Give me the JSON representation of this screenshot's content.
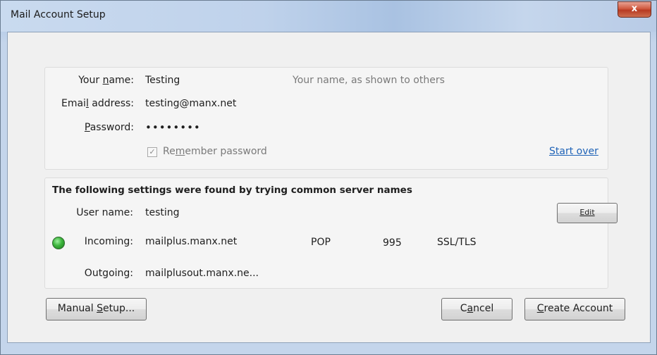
{
  "window": {
    "title": "Mail Account Setup",
    "close_glyph": "x"
  },
  "identity": {
    "name_label_pre": "Your ",
    "name_label_u": "n",
    "name_label_post": "ame:",
    "name_value": "Testing",
    "name_hint": "Your name, as shown to others",
    "email_label_pre": "Emai",
    "email_label_u": "l",
    "email_label_post": " address:",
    "email_value": "testing@manx.net",
    "password_label_u": "P",
    "password_label_post": "assword:",
    "password_value": "••••••••",
    "remember_pre": "Re",
    "remember_u": "m",
    "remember_post": "ember password",
    "remember_checked": true,
    "start_over": "Start over"
  },
  "settings": {
    "heading": "The following settings were found by trying common server names",
    "username_label": "User name:",
    "username_value": "testing",
    "edit_button": "Edit",
    "incoming_label": "Incoming:",
    "incoming_server": "mailplus.manx.net",
    "incoming_protocol": "POP",
    "incoming_port": "995",
    "incoming_security": "SSL/TLS",
    "incoming_status_color": "#3cb43c",
    "outgoing_label": "Outgoing:",
    "outgoing_server": "mailplusout.manx.ne..."
  },
  "buttons": {
    "manual_setup_u": "S",
    "manual_setup_pre": "Manual ",
    "manual_setup_post": "etup...",
    "cancel_pre": "C",
    "cancel_u": "a",
    "cancel_post": "ncel",
    "create_u": "C",
    "create_post": "reate Account"
  }
}
